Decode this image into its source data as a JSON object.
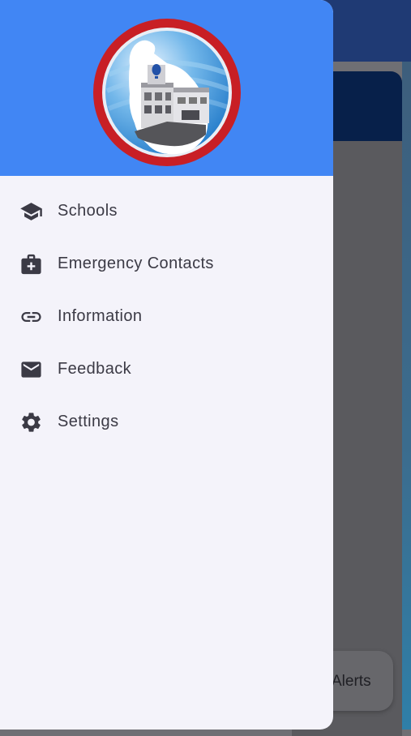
{
  "drawer": {
    "menu_items": [
      {
        "label": "Schools",
        "icon": "school-icon"
      },
      {
        "label": "Emergency Contacts",
        "icon": "medical-bag-icon"
      },
      {
        "label": "Information",
        "icon": "link-icon"
      },
      {
        "label": "Feedback",
        "icon": "mail-icon"
      },
      {
        "label": "Settings",
        "icon": "gear-icon"
      }
    ]
  },
  "background": {
    "alerts_label": "Alerts"
  },
  "colors": {
    "header": "#4186f4",
    "drawer_bg": "#f4f3fa",
    "logo_ring": "#c81f25",
    "text": "#3b3a45"
  }
}
